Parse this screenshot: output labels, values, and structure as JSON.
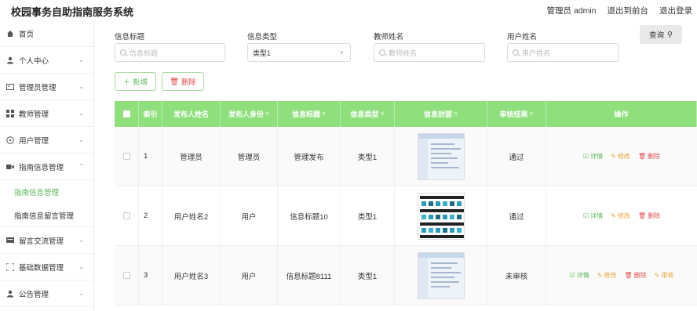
{
  "app": {
    "title": "校园事务自助指南服务系统",
    "user_label": "管理员 admin",
    "frontend_link": "退出到前台",
    "logout_link": "退出登录"
  },
  "sidebar": {
    "items": [
      {
        "label": "首页",
        "icon": "home-icon"
      },
      {
        "label": "个人中心",
        "icon": "user-icon"
      },
      {
        "label": "管理员管理",
        "icon": "admin-card-icon"
      },
      {
        "label": "教师管理",
        "icon": "grid-icon"
      },
      {
        "label": "用户管理",
        "icon": "compass-icon"
      },
      {
        "label": "指南信息管理",
        "icon": "video-icon"
      },
      {
        "label": "留言交流管理",
        "icon": "message-icon"
      },
      {
        "label": "基础数据管理",
        "icon": "frame-icon"
      },
      {
        "label": "公告管理",
        "icon": "user-icon"
      }
    ],
    "sub_items": [
      {
        "label": "指南信息管理",
        "active": true
      },
      {
        "label": "指南信息留言管理",
        "active": false
      }
    ]
  },
  "filters": {
    "title_label": "信息标题",
    "title_placeholder": "信息标题",
    "type_label": "信息类型",
    "type_value": "类型1",
    "teacher_label": "教师姓名",
    "teacher_placeholder": "教师姓名",
    "user_label": "用户姓名",
    "user_placeholder": "用户姓名",
    "query_button": "查询"
  },
  "actions": {
    "add_label": "新增",
    "delete_label": "删除"
  },
  "table": {
    "headers": [
      "索引",
      "发布人姓名",
      "发布人身份",
      "信息标题",
      "信息类型",
      "信息封面",
      "审核结果",
      "操作"
    ],
    "rows": [
      {
        "index": "1",
        "publisher": "管理员",
        "role": "管理员",
        "title": "管理发布",
        "type": "类型1",
        "cover": "screenshot-thumbnail",
        "status": "通过",
        "ops": [
          "详情",
          "修改",
          "删除"
        ]
      },
      {
        "index": "2",
        "publisher": "用户姓名2",
        "role": "用户",
        "title": "信息标题10",
        "type": "类型1",
        "cover": "icon-grid-thumbnail",
        "status": "通过",
        "ops": [
          "详情",
          "修改",
          "删除"
        ]
      },
      {
        "index": "3",
        "publisher": "用户姓名3",
        "role": "用户",
        "title": "信息标题8111",
        "type": "类型1",
        "cover": "screenshot-thumbnail",
        "status": "未审核",
        "ops": [
          "详情",
          "修改",
          "删除",
          "审核"
        ]
      }
    ]
  },
  "colors": {
    "accent": "#8fe07d",
    "active_text": "#5cb85c",
    "danger": "#e05050",
    "warning": "#e8a33a"
  }
}
